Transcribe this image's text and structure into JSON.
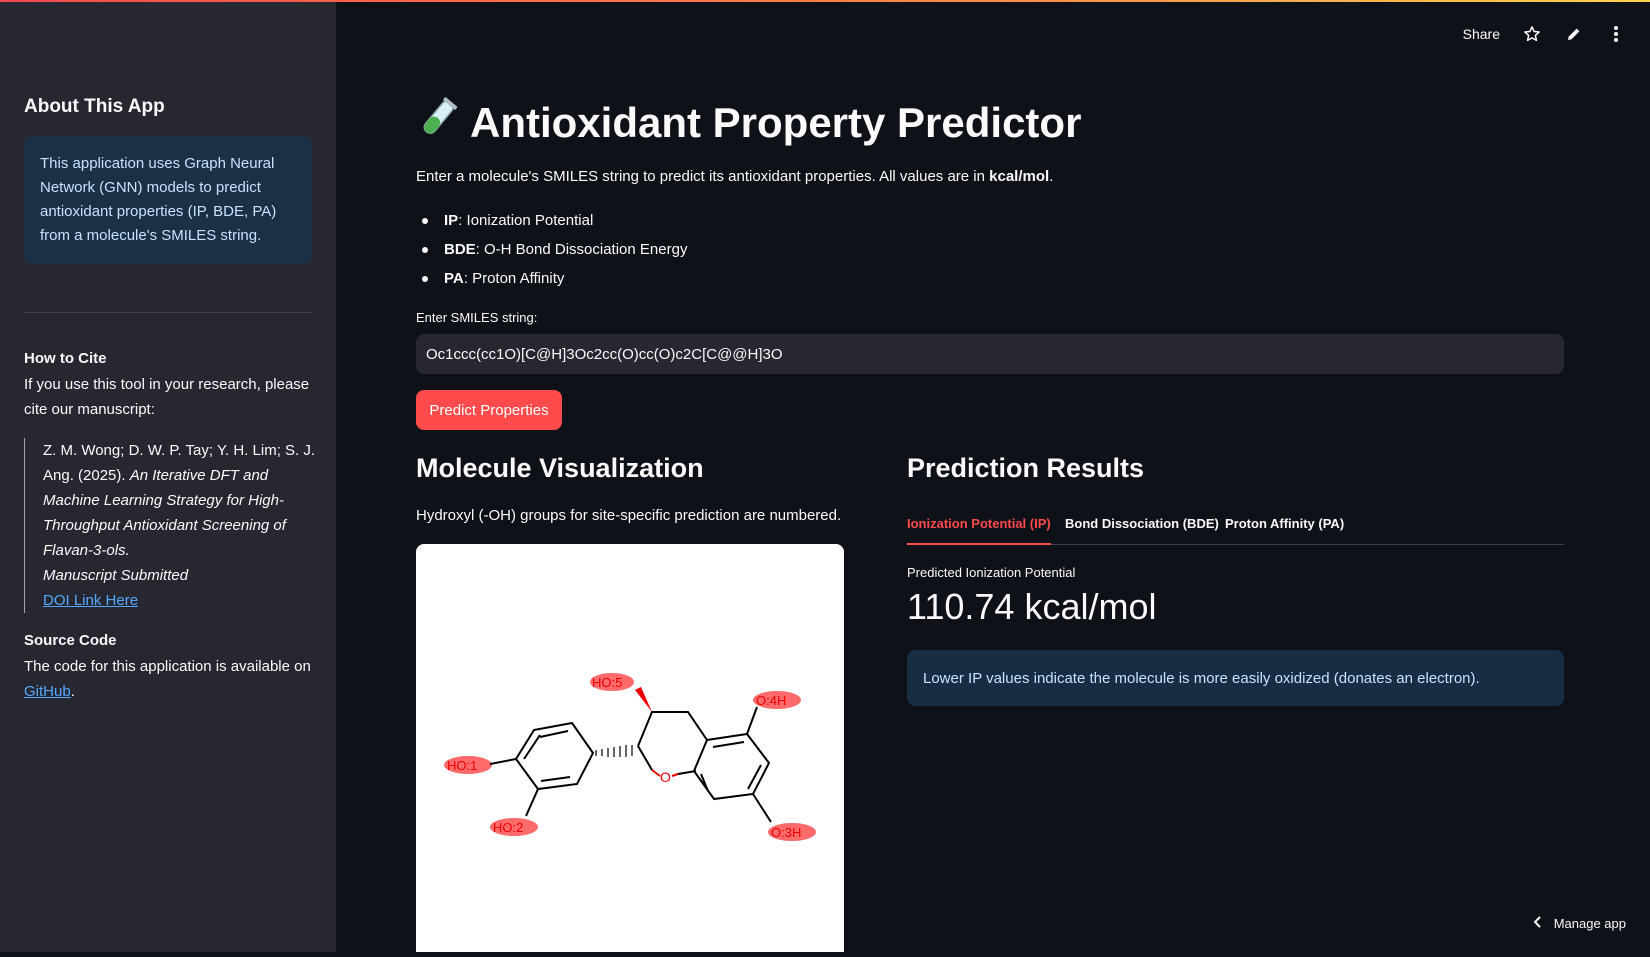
{
  "sidebar": {
    "about_heading": "About This App",
    "about_text": "This application uses Graph Neural Network (GNN) models to predict antioxidant properties (IP, BDE, PA) from a molecule's SMILES string.",
    "cite_heading": "How to Cite",
    "cite_text": "If you use this tool in your research, please cite our manuscript:",
    "cite_authors": "Z. M. Wong; D. W. P. Tay; Y. H. Lim; S. J. Ang. (2025).",
    "cite_title": "An Iterative DFT and Machine Learning Strategy for High-Throughput Antioxidant Screening of Flavan-3-ols.",
    "cite_status": "Manuscript Submitted",
    "doi_link": "DOI Link Here",
    "source_heading": "Source Code",
    "source_text": "The code for this application is available on",
    "github_link": "GitHub",
    "source_end": "."
  },
  "header": {
    "share": "Share",
    "star_icon": "star-icon",
    "edit_icon": "pencil-icon",
    "menu_icon": "kebab-menu-icon"
  },
  "main": {
    "title_icon": "test-tube-icon",
    "title": "Antioxidant Property Predictor",
    "intro_pre": "Enter a molecule's SMILES string to predict its antioxidant properties. All values are in ",
    "intro_unit": "kcal/mol",
    "intro_end": ".",
    "properties": [
      {
        "abbr": "IP",
        "desc": "Ionization Potential"
      },
      {
        "abbr": "BDE",
        "desc": "O-H Bond Dissociation Energy"
      },
      {
        "abbr": "PA",
        "desc": "Proton Affinity"
      }
    ],
    "smiles_label": "Enter SMILES string:",
    "smiles_value": "Oc1ccc(cc1O)[C@H]3Oc2cc(O)cc(O)c2C[C@@H]3O",
    "predict_button": "Predict Properties"
  },
  "molecule": {
    "heading": "Molecule Visualization",
    "subtitle": "Hydroxyl (-OH) groups for site-specific prediction are numbered.",
    "labels": [
      "HO:1",
      "HO:2",
      "O:3H",
      "O:4H",
      "HO:5"
    ],
    "ring_oxygen": "O"
  },
  "results": {
    "heading": "Prediction Results",
    "tabs": [
      "Ionization Potential (IP)",
      "Bond Dissociation (BDE)",
      "Proton Affinity (PA)"
    ],
    "metric_label": "Predicted Ionization Potential",
    "metric_value": "110.74 kcal/mol",
    "note": "Lower IP values indicate the molecule is more easily oxidized (donates an electron)."
  },
  "footer": {
    "manage_app": "Manage app",
    "chevron_icon": "chevron-left-icon"
  },
  "colors": {
    "accent": "#ff4b4b",
    "background": "#0e1117",
    "sidebar": "#262730",
    "info": "#1c2f45"
  }
}
